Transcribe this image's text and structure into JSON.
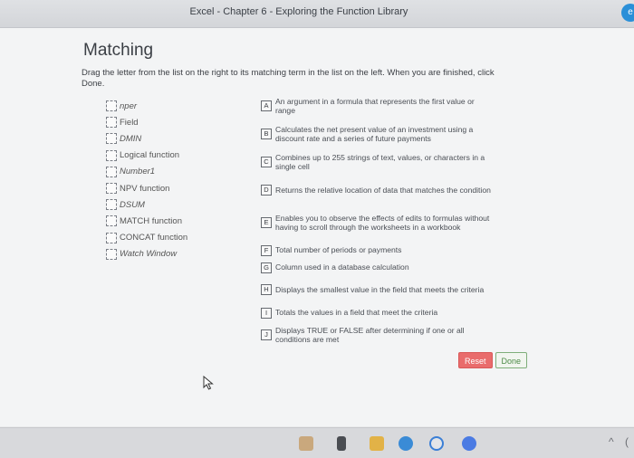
{
  "window": {
    "title": "Excel - Chapter 6 - Exploring the Function Library"
  },
  "header": {
    "title": "Matching"
  },
  "instructions": "Drag the letter from the list on the right to its matching term in the list on the left. When you are finished, click Done.",
  "terms": [
    {
      "label": "nper",
      "italic": true
    },
    {
      "label": "Field",
      "italic": false
    },
    {
      "label": "DMIN",
      "italic": true
    },
    {
      "label": "Logical function",
      "italic": false
    },
    {
      "label": "Number1",
      "italic": true
    },
    {
      "label": "NPV function",
      "italic": false
    },
    {
      "label": "DSUM",
      "italic": true
    },
    {
      "label": "MATCH function",
      "italic": false
    },
    {
      "label": "CONCAT function",
      "italic": false
    },
    {
      "label": "Watch Window",
      "italic": true
    }
  ],
  "definitions": [
    {
      "letter": "A",
      "text": "An argument in a formula that represents the first value or range"
    },
    {
      "letter": "B",
      "text": "Calculates the net present value of an investment using a discount rate and a series of future payments"
    },
    {
      "letter": "C",
      "text": "Combines up to 255 strings of text, values, or characters in a single cell"
    },
    {
      "letter": "D",
      "text": "Returns the relative location of data that matches the condition"
    },
    {
      "letter": "E",
      "text": "Enables you to observe the effects of edits to formulas without having to scroll through the worksheets in a workbook"
    },
    {
      "letter": "F",
      "text": "Total number of periods or payments"
    },
    {
      "letter": "G",
      "text": "Column used in a database calculation"
    },
    {
      "letter": "H",
      "text": "Displays the smallest value in the field that meets the criteria"
    },
    {
      "letter": "I",
      "text": "Totals the values in a field that meet the criteria"
    },
    {
      "letter": "J",
      "text": "Displays TRUE or FALSE after determining if one or all conditions are met"
    }
  ],
  "buttons": {
    "reset": "Reset",
    "done": "Done"
  },
  "colors": {
    "reset": "#e96c6c",
    "done_text": "#4c8a46",
    "page": "#f3f4f5"
  }
}
